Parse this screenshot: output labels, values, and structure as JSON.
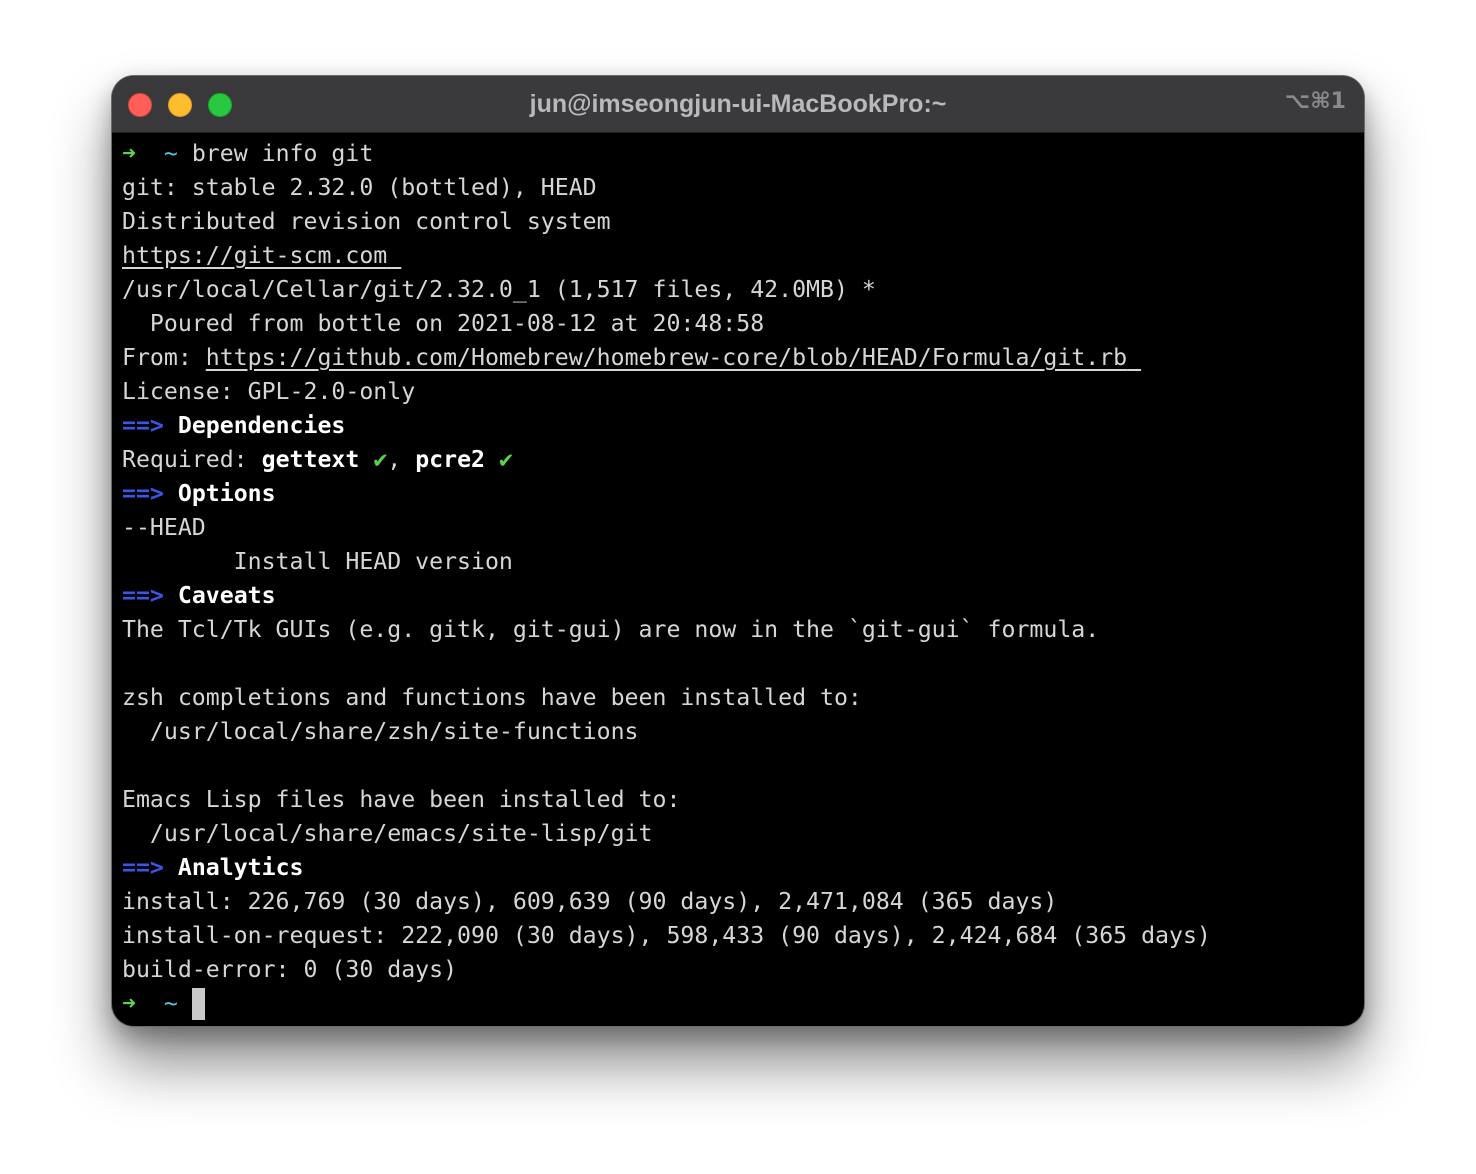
{
  "window": {
    "title": "jun@imseongjun-ui-MacBookPro:~",
    "shortcut": "⌥⌘1"
  },
  "colors": {
    "background": "#000000",
    "text": "#d6d6d6",
    "prompt_arrow": "#5ad44c",
    "prompt_tilde": "#56c5e6",
    "section_arrow": "#3b55e6",
    "check": "#5ad44c"
  },
  "prompt": {
    "arrow": "➜",
    "dir": "~"
  },
  "terminal": {
    "command": "brew info git",
    "line_version": "git: stable 2.32.0 (bottled), HEAD",
    "line_desc": "Distributed revision control system",
    "homepage": "https://git-scm.com",
    "cellar": "/usr/local/Cellar/git/2.32.0_1 (1,517 files, 42.0MB) *",
    "poured": "  Poured from bottle on 2021-08-12 at 20:48:58",
    "from_label": "From: ",
    "from_url": "https://github.com/Homebrew/homebrew-core/blob/HEAD/Formula/git.rb",
    "license": "License: GPL-2.0-only",
    "section_arrow": "==>",
    "dependencies_header": "Dependencies",
    "required_label": "Required: ",
    "dep1": "gettext",
    "check": "✔",
    "dep_sep": ", ",
    "dep2": "pcre2",
    "options_header": "Options",
    "option_flag": "--HEAD",
    "option_desc": "        Install HEAD version",
    "caveats_header": "Caveats",
    "caveat1": "The Tcl/Tk GUIs (e.g. gitk, git-gui) are now in the `git-gui` formula.",
    "caveat2": "zsh completions and functions have been installed to:",
    "caveat3": "  /usr/local/share/zsh/site-functions",
    "caveat4": "Emacs Lisp files have been installed to:",
    "caveat5": "  /usr/local/share/emacs/site-lisp/git",
    "analytics_header": "Analytics",
    "analytics1": "install: 226,769 (30 days), 609,639 (90 days), 2,471,084 (365 days)",
    "analytics2": "install-on-request: 222,090 (30 days), 598,433 (90 days), 2,424,684 (365 days)",
    "analytics3": "build-error: 0 (30 days)"
  }
}
